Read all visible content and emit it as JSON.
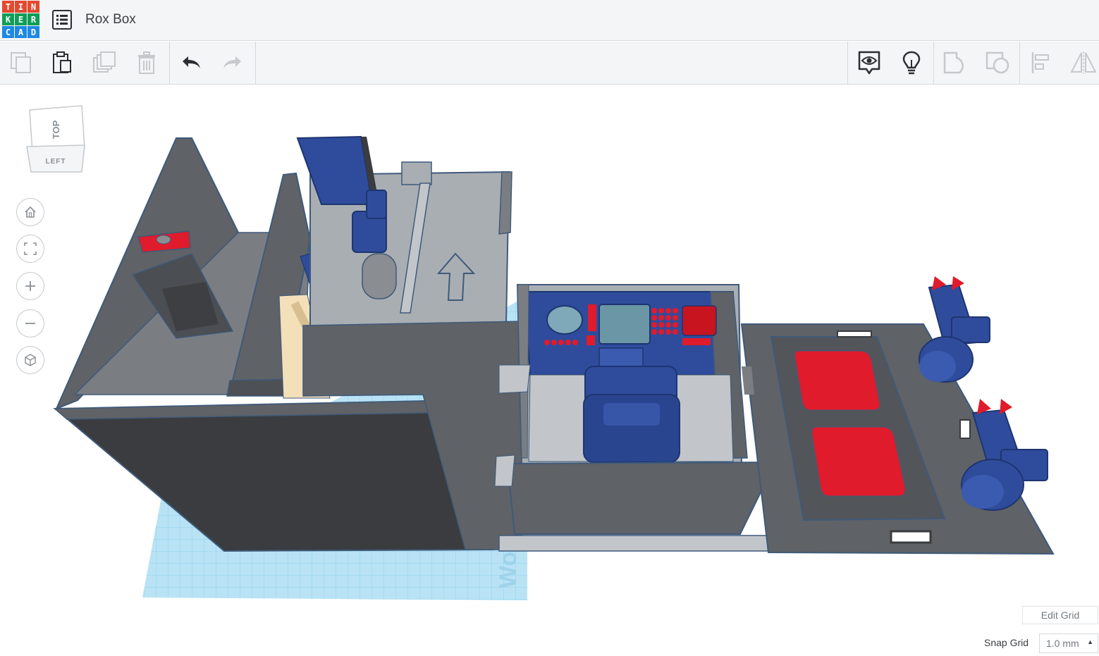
{
  "app": {
    "logo_letters": [
      "T",
      "I",
      "N",
      "K",
      "E",
      "R",
      "C",
      "A",
      "D"
    ],
    "logo_colors": [
      "#e2492f",
      "#e2492f",
      "#e2492f",
      "#0f9d58",
      "#0f9d58",
      "#0f9d58",
      "#1e88e5",
      "#1e88e5",
      "#1e88e5"
    ],
    "project_title": "Rox Box"
  },
  "toolbar": {
    "left": [
      {
        "name": "copy-icon",
        "enabled": false
      },
      {
        "name": "paste-icon",
        "enabled": true
      },
      {
        "name": "duplicate-icon",
        "enabled": false
      },
      {
        "name": "delete-icon",
        "enabled": false
      },
      {
        "name": "undo-icon",
        "enabled": true
      },
      {
        "name": "redo-icon",
        "enabled": false
      }
    ],
    "right": [
      {
        "name": "notes-eye-icon",
        "enabled": true
      },
      {
        "name": "lightbulb-icon",
        "enabled": true
      },
      {
        "name": "group-icon",
        "enabled": false
      },
      {
        "name": "ungroup-icon",
        "enabled": false
      },
      {
        "name": "align-icon",
        "enabled": false
      },
      {
        "name": "mirror-icon",
        "enabled": false
      }
    ]
  },
  "viewcube": {
    "top_label": "TOP",
    "left_label": "LEFT"
  },
  "nav": [
    "home-view-icon",
    "fit-all-icon",
    "zoom-in-icon",
    "zoom-out-icon",
    "perspective-icon"
  ],
  "workplane": {
    "watermark": "Wo"
  },
  "grid": {
    "edit_label": "Edit Grid",
    "snap_label": "Snap Grid",
    "snap_value": "1.0 mm"
  },
  "colors": {
    "model_gray": "#5f6266",
    "model_dark": "#3a3c3f",
    "floor_light": "#a9aeb3",
    "accent_blue": "#2f4c9c",
    "accent_red": "#e01b2b",
    "grid_blue": "#b9e3f5"
  }
}
